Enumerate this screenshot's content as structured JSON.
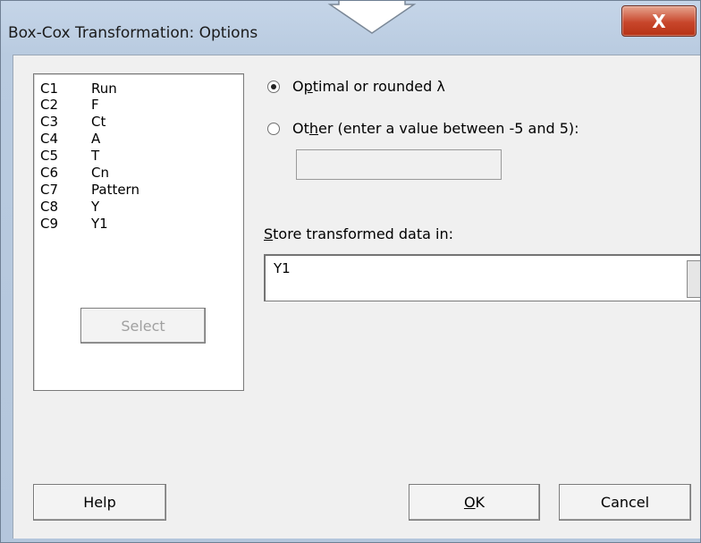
{
  "window": {
    "title": "Box-Cox Transformation: Options",
    "close_glyph": "X"
  },
  "variables": [
    {
      "col": "C1",
      "name": "Run"
    },
    {
      "col": "C2",
      "name": "F"
    },
    {
      "col": "C3",
      "name": "Ct"
    },
    {
      "col": "C4",
      "name": "A"
    },
    {
      "col": "C5",
      "name": "T"
    },
    {
      "col": "C6",
      "name": "Cn"
    },
    {
      "col": "C7",
      "name": "Pattern"
    },
    {
      "col": "C8",
      "name": "Y"
    },
    {
      "col": "C9",
      "name": "Y1"
    }
  ],
  "options": {
    "optimal_pre": "O",
    "optimal_ul": "p",
    "optimal_post": "timal or rounded λ",
    "other_pre": "Ot",
    "other_ul": "h",
    "other_post": "er (enter a value between -5 and 5):",
    "other_value": "",
    "selected": "optimal"
  },
  "store": {
    "label_ul": "S",
    "label_post": "tore transformed data in:",
    "value": "Y1"
  },
  "buttons": {
    "select": "Select",
    "help": "Help",
    "ok_ul": "O",
    "ok_post": "K",
    "cancel": "Cancel"
  }
}
